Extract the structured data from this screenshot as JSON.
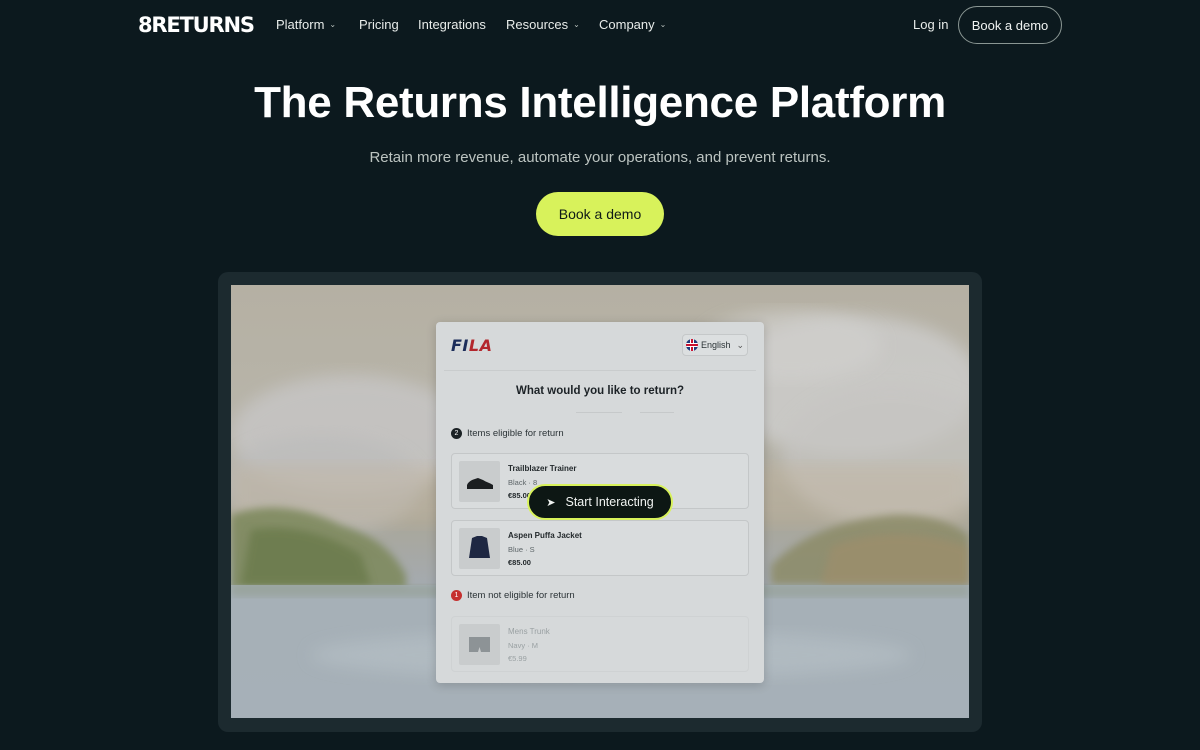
{
  "nav": {
    "logo": "8RETURNS",
    "links": [
      {
        "label": "Platform",
        "dropdown": true
      },
      {
        "label": "Pricing",
        "dropdown": false
      },
      {
        "label": "Integrations",
        "dropdown": false
      },
      {
        "label": "Resources",
        "dropdown": true
      },
      {
        "label": "Company",
        "dropdown": true
      }
    ],
    "login": "Log in",
    "demo": "Book a demo",
    "chevron_icon": "chevron-down-icon"
  },
  "hero": {
    "title": "The Returns Intelligence Platform",
    "subtitle": "Retain more revenue, automate your operations, and prevent returns.",
    "cta": "Book a demo"
  },
  "demo": {
    "brand_left": "FI",
    "brand_right": "LA",
    "language": "English",
    "question": "What would you like to return?",
    "eligible_label": "Items eligible for return",
    "eligible_count": "2",
    "eligible_items": [
      {
        "name": "Trailblazer Trainer",
        "variant": "Black  ·  8",
        "price": "€85.00"
      },
      {
        "name": "Aspen Puffa Jacket",
        "variant": "Blue  ·  S",
        "price": "€85.00"
      }
    ],
    "ineligible_label": "Item not eligible for return",
    "ineligible_count": "1",
    "ineligible_items": [
      {
        "name": "Mens Trunk",
        "variant": "Navy  ·  M",
        "price": "€5.99"
      }
    ],
    "start_button": "Start Interacting",
    "colors": {
      "accent": "#d8f25b",
      "background": "#0c191e",
      "fila_navy": "#1c2d5a",
      "fila_red": "#b3262c"
    }
  }
}
